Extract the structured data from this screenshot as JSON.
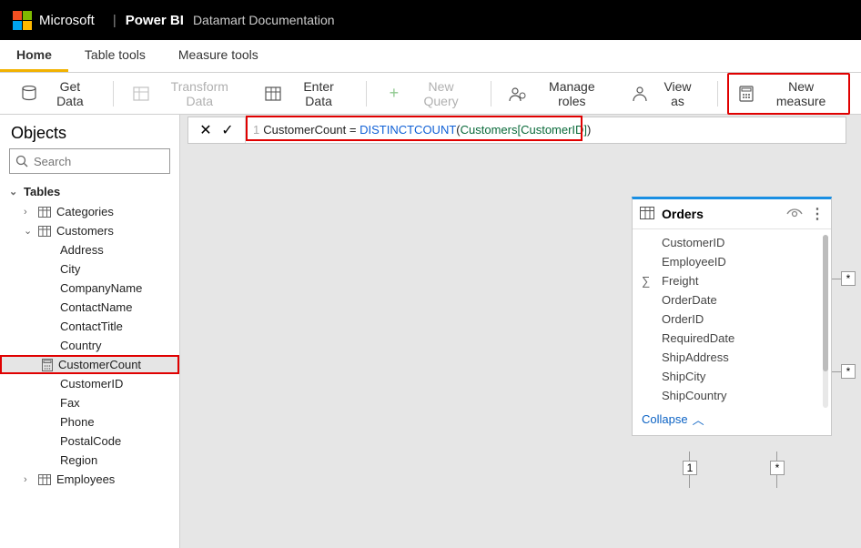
{
  "header": {
    "brand": "Microsoft",
    "product": "Power BI",
    "document": "Datamart Documentation"
  },
  "tabs": {
    "home": "Home",
    "table_tools": "Table tools",
    "measure_tools": "Measure tools"
  },
  "ribbon": {
    "get_data": "Get Data",
    "transform_data": "Transform Data",
    "enter_data": "Enter Data",
    "new_query": "New Query",
    "manage_roles": "Manage roles",
    "view_as": "View as",
    "new_measure": "New measure"
  },
  "sidebar": {
    "title": "Objects",
    "search_placeholder": "Search",
    "tables_label": "Tables",
    "categories": "Categories",
    "customers": "Customers",
    "employees": "Employees",
    "fields": {
      "address": "Address",
      "city": "City",
      "company_name": "CompanyName",
      "contact_name": "ContactName",
      "contact_title": "ContactTitle",
      "country": "Country",
      "customer_count": "CustomerCount",
      "customer_id": "CustomerID",
      "fax": "Fax",
      "phone": "Phone",
      "postal_code": "PostalCode",
      "region": "Region"
    }
  },
  "formula": {
    "line": "1",
    "measure_name": "CustomerCount",
    "equals": " = ",
    "func": "DISTINCTCOUNT",
    "open": "(",
    "ref": "Customers[CustomerID]",
    "close": ")"
  },
  "orders_card": {
    "title": "Orders",
    "fields": {
      "customer_id": "CustomerID",
      "employee_id": "EmployeeID",
      "freight": "Freight",
      "order_date": "OrderDate",
      "order_id": "OrderID",
      "required_date": "RequiredDate",
      "ship_address": "ShipAddress",
      "ship_city": "ShipCity",
      "ship_country": "ShipCountry"
    },
    "collapse": "Collapse"
  },
  "rel": {
    "star": "*",
    "one": "1"
  }
}
